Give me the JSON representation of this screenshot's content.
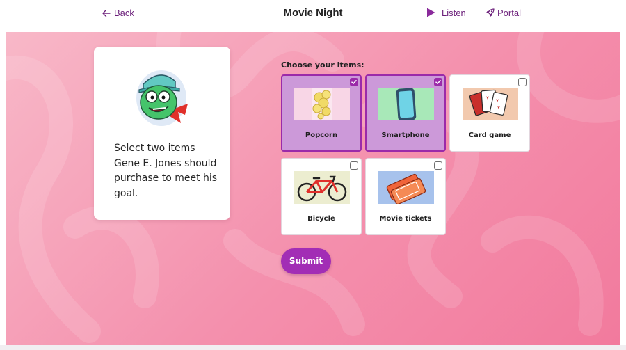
{
  "header": {
    "back_label": "Back",
    "title": "Movie Night",
    "listen_label": "Listen",
    "portal_label": "Portal"
  },
  "prompt": {
    "text": "Select two items Gene E. Jones should purchase to meet his goal."
  },
  "choices": {
    "heading": "Choose your items:",
    "items": [
      {
        "label": "Popcorn",
        "selected": true,
        "icon": "popcorn-icon"
      },
      {
        "label": "Smartphone",
        "selected": true,
        "icon": "smartphone-icon"
      },
      {
        "label": "Card game",
        "selected": false,
        "icon": "playing-cards-icon"
      },
      {
        "label": "Bicycle",
        "selected": false,
        "icon": "bicycle-icon"
      },
      {
        "label": "Movie tickets",
        "selected": false,
        "icon": "movie-tickets-icon"
      }
    ]
  },
  "submit_label": "Submit",
  "colors": {
    "accent": "#9b2aa9",
    "selected_tile": "#cc99d9",
    "link": "#6b1f7a",
    "background": "#f490ad"
  }
}
